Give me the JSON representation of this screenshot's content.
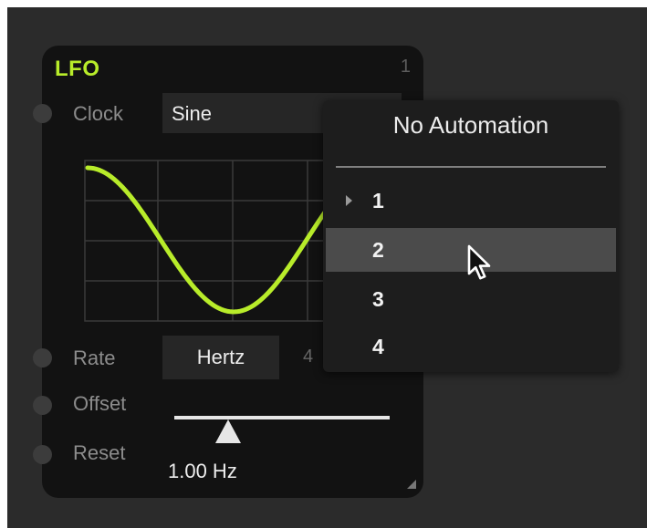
{
  "lfo": {
    "title": "LFO",
    "number": "1",
    "accent_color": "#b8ec2a",
    "clock_label": "Clock",
    "waveform": "Sine",
    "rate_label": "Rate",
    "rate_unit": "Hertz",
    "rate_partial_value": "4",
    "offset_label": "Offset",
    "reset_label": "Reset",
    "slider_readout": "1.00 Hz",
    "slider_position": 0.25
  },
  "menu": {
    "title": "No Automation",
    "items": [
      {
        "label": "1",
        "has_arrow": true
      },
      {
        "label": "2",
        "highlighted": true
      },
      {
        "label": "3"
      },
      {
        "label": "4"
      }
    ]
  },
  "icons": {
    "cursor": "pointer-arrow-icon",
    "submenu": "submenu-arrow-icon",
    "resize": "resize-handle-icon"
  }
}
